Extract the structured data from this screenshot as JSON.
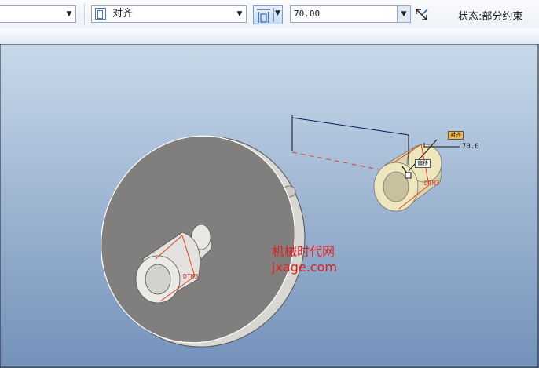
{
  "toolbar": {
    "first_combo_value": "",
    "constraint_type": "对齐",
    "offset_value": "70.00",
    "status_label": "状态:部分约束"
  },
  "viewport": {
    "dimension_value": "70.0",
    "align_tag": "对齐",
    "offset_tag": "偏移",
    "datum_label_left": "DTM3",
    "datum_label_right": "DTM3",
    "watermark_line1": "机械时代网",
    "watermark_line2": "jxage.com"
  },
  "colors": {
    "accent": "#e02020",
    "background_top": "#c8d9ea",
    "background_bottom": "#7391b9"
  }
}
